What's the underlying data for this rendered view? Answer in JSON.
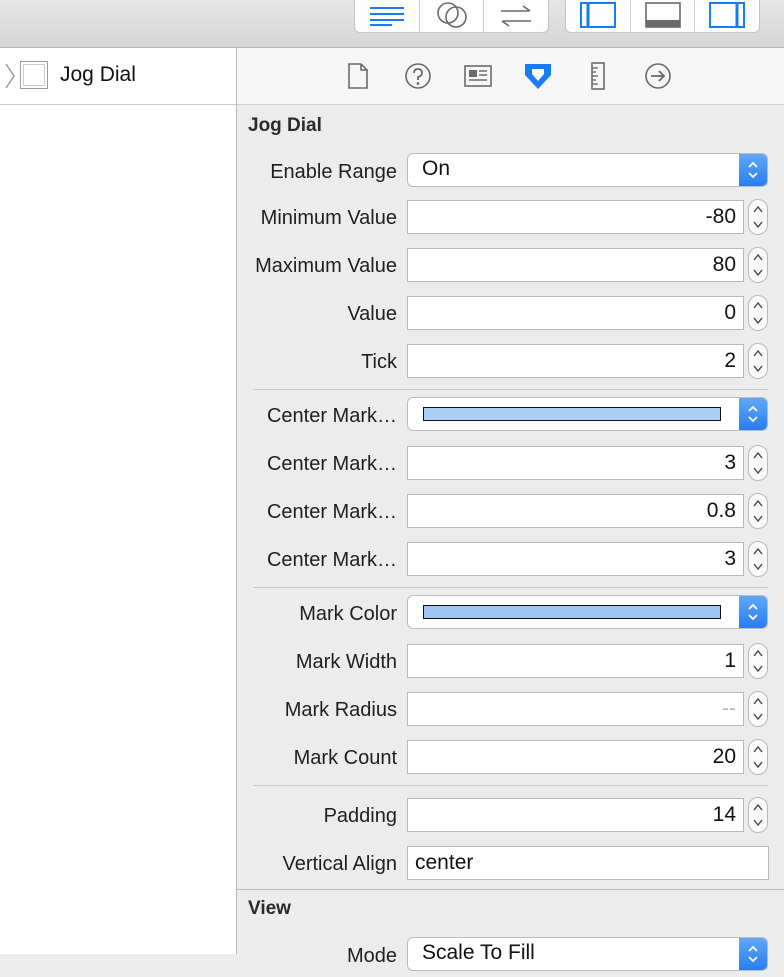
{
  "navigator": {
    "item_label": "Jog Dial"
  },
  "inspector": {
    "section_title": "Jog Dial",
    "rows": [
      {
        "label": "Enable Range",
        "kind": "popup",
        "value": "On"
      },
      {
        "label": "Minimum Value",
        "kind": "number",
        "value": "-80"
      },
      {
        "label": "Maximum Value",
        "kind": "number",
        "value": "80"
      },
      {
        "label": "Value",
        "kind": "number",
        "value": "0"
      },
      {
        "label": "Tick",
        "kind": "number",
        "value": "2"
      },
      {
        "label": "Center Mark…",
        "kind": "color",
        "color": "#a9cdf7"
      },
      {
        "label": "Center Mark…",
        "kind": "number",
        "value": "3"
      },
      {
        "label": "Center Mark…",
        "kind": "number",
        "value": "0.8"
      },
      {
        "label": "Center Mark…",
        "kind": "number",
        "value": "3"
      },
      {
        "label": "Mark Color",
        "kind": "color",
        "color": "#9ec6f5"
      },
      {
        "label": "Mark Width",
        "kind": "number",
        "value": "1"
      },
      {
        "label": "Mark Radius",
        "kind": "number",
        "value": "--"
      },
      {
        "label": "Mark Count",
        "kind": "number",
        "value": "20"
      },
      {
        "label": "Padding",
        "kind": "number",
        "value": "14"
      },
      {
        "label": "Vertical Align",
        "kind": "text",
        "value": "center"
      }
    ],
    "view_section": {
      "title": "View",
      "mode_label": "Mode",
      "mode_value": "Scale To Fill"
    }
  },
  "colors": {
    "accent": "#2a7df0",
    "tab_active": "#1a7cf5"
  }
}
